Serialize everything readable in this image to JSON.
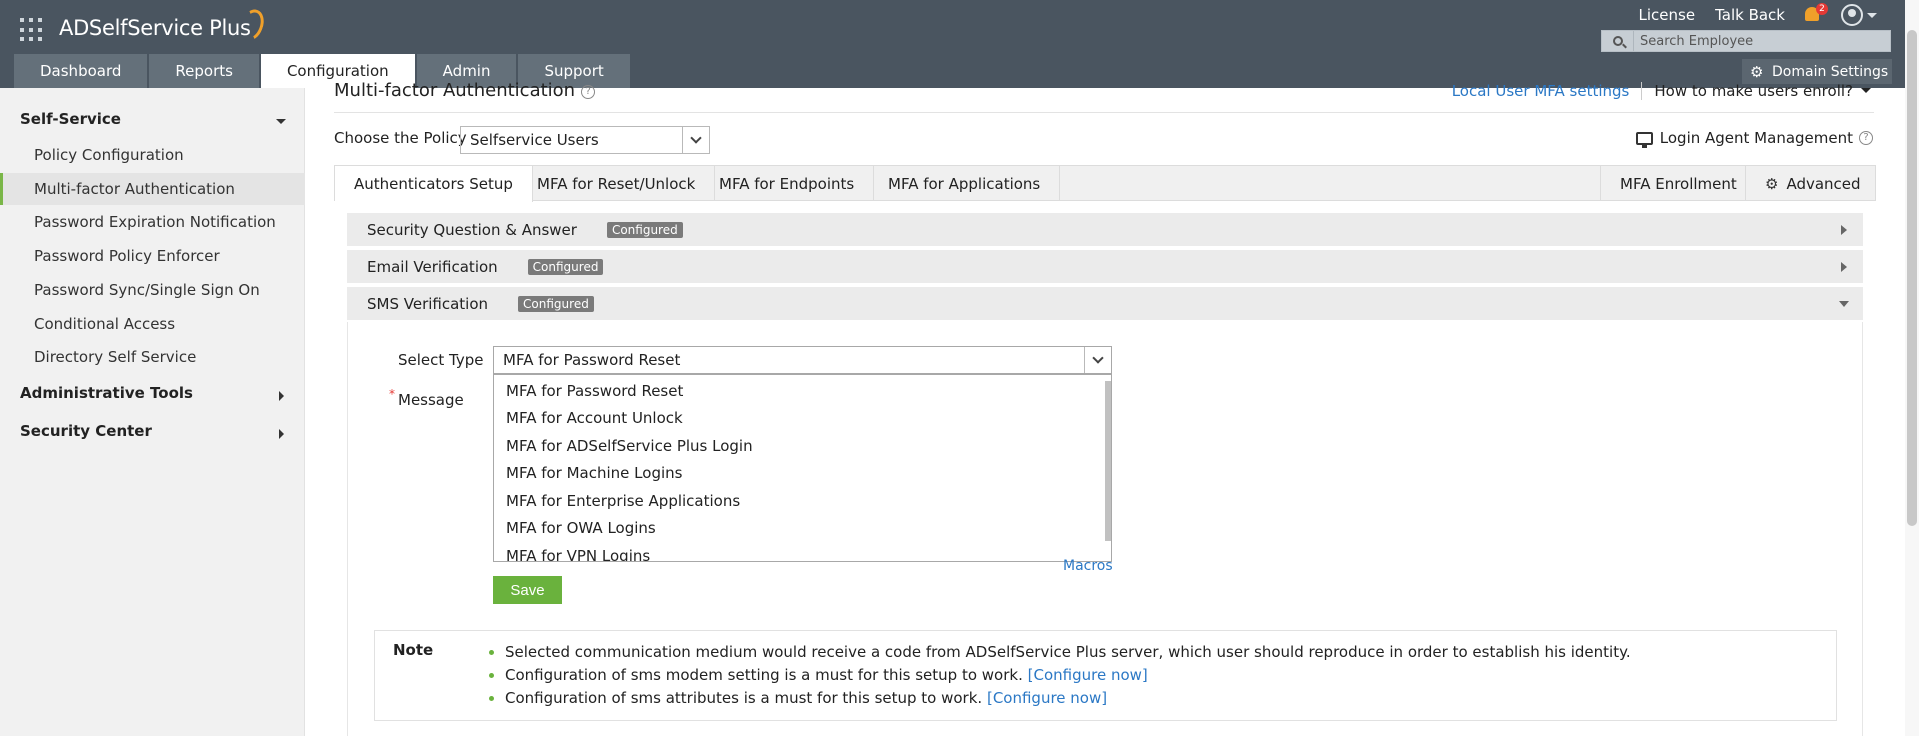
{
  "app": {
    "name": "ADSelfService Plus"
  },
  "header": {
    "links": [
      "License",
      "Talk Back"
    ],
    "notification_count": "2",
    "search_placeholder": "Search Employee",
    "domain_settings": "Domain Settings"
  },
  "nav": {
    "tabs": [
      {
        "label": "Dashboard",
        "active": false
      },
      {
        "label": "Reports",
        "active": false
      },
      {
        "label": "Configuration",
        "active": true
      },
      {
        "label": "Admin",
        "active": false
      },
      {
        "label": "Support",
        "active": false
      }
    ]
  },
  "sidebar": {
    "sections": [
      {
        "title": "Self-Service",
        "expanded": true
      },
      {
        "title": "Administrative Tools",
        "expanded": false
      },
      {
        "title": "Security Center",
        "expanded": false
      }
    ],
    "items": [
      {
        "label": "Policy Configuration",
        "active": false
      },
      {
        "label": "Multi-factor Authentication",
        "active": true
      },
      {
        "label": "Password Expiration Notification",
        "active": false
      },
      {
        "label": "Password Policy Enforcer",
        "active": false
      },
      {
        "label": "Password Sync/Single Sign On",
        "active": false
      },
      {
        "label": "Conditional Access",
        "active": false
      },
      {
        "label": "Directory Self Service",
        "active": false
      }
    ]
  },
  "main": {
    "title": "Multi-factor Authentication",
    "local_mfa_link": "Local User MFA settings",
    "enroll_menu": "How to make users enroll?",
    "policy_label": "Choose the Policy",
    "policy_value": "Selfservice Users",
    "login_agent": "Login Agent Management",
    "subtabs": [
      {
        "label": "Authenticators Setup",
        "active": true
      },
      {
        "label": "MFA for Reset/Unlock",
        "active": false
      },
      {
        "label": "MFA for Endpoints",
        "active": false
      },
      {
        "label": "MFA for Applications",
        "active": false
      }
    ],
    "subtabs_right": [
      "MFA Enrollment",
      "Advanced"
    ],
    "authenticators": [
      {
        "label": "Security Question & Answer",
        "status": "Configured",
        "expanded": false
      },
      {
        "label": "Email Verification",
        "status": "Configured",
        "expanded": false
      },
      {
        "label": "SMS Verification",
        "status": "Configured",
        "expanded": true
      }
    ],
    "form": {
      "select_type_label": "Select Type",
      "select_type_value": "MFA for Password Reset",
      "message_label": "Message",
      "options": [
        "MFA for Password Reset",
        "MFA for Account Unlock",
        "MFA for ADSelfService Plus Login",
        "MFA for Machine Logins",
        "MFA for Enterprise Applications",
        "MFA for OWA Logins",
        "MFA for VPN Logins"
      ],
      "macros": "Macros",
      "save": "Save"
    },
    "note": {
      "title": "Note",
      "lines": [
        {
          "text": "Selected communication medium would receive a code from ADSelfService Plus server, which user should reproduce in order to establish his identity.",
          "link": ""
        },
        {
          "text": "Configuration of sms modem setting is a must for this setup to work.",
          "link": "[Configure now]"
        },
        {
          "text": "Configuration of sms attributes is a must for this setup to work.",
          "link": "[Configure now]"
        }
      ]
    }
  },
  "colors": {
    "header": "#4a5560",
    "accent_green": "#6ab23d",
    "link_blue": "#2b78c5",
    "badge_grey": "#7a7a7a"
  }
}
